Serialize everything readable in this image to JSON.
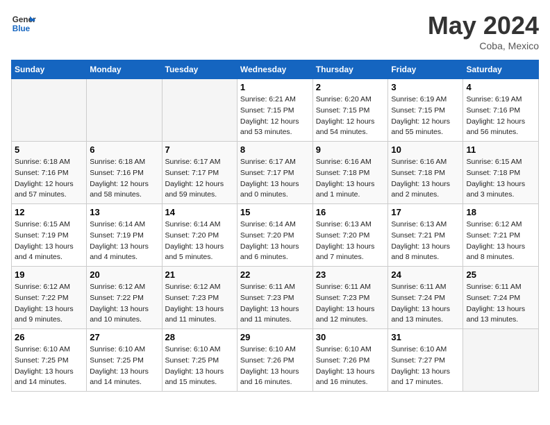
{
  "logo": {
    "line1": "General",
    "line2": "Blue"
  },
  "title": "May 2024",
  "location": "Coba, Mexico",
  "days_header": [
    "Sunday",
    "Monday",
    "Tuesday",
    "Wednesday",
    "Thursday",
    "Friday",
    "Saturday"
  ],
  "weeks": [
    [
      {
        "day": "",
        "sunrise": "",
        "sunset": "",
        "daylight": ""
      },
      {
        "day": "",
        "sunrise": "",
        "sunset": "",
        "daylight": ""
      },
      {
        "day": "",
        "sunrise": "",
        "sunset": "",
        "daylight": ""
      },
      {
        "day": "1",
        "sunrise": "Sunrise: 6:21 AM",
        "sunset": "Sunset: 7:15 PM",
        "daylight": "Daylight: 12 hours and 53 minutes."
      },
      {
        "day": "2",
        "sunrise": "Sunrise: 6:20 AM",
        "sunset": "Sunset: 7:15 PM",
        "daylight": "Daylight: 12 hours and 54 minutes."
      },
      {
        "day": "3",
        "sunrise": "Sunrise: 6:19 AM",
        "sunset": "Sunset: 7:15 PM",
        "daylight": "Daylight: 12 hours and 55 minutes."
      },
      {
        "day": "4",
        "sunrise": "Sunrise: 6:19 AM",
        "sunset": "Sunset: 7:16 PM",
        "daylight": "Daylight: 12 hours and 56 minutes."
      }
    ],
    [
      {
        "day": "5",
        "sunrise": "Sunrise: 6:18 AM",
        "sunset": "Sunset: 7:16 PM",
        "daylight": "Daylight: 12 hours and 57 minutes."
      },
      {
        "day": "6",
        "sunrise": "Sunrise: 6:18 AM",
        "sunset": "Sunset: 7:16 PM",
        "daylight": "Daylight: 12 hours and 58 minutes."
      },
      {
        "day": "7",
        "sunrise": "Sunrise: 6:17 AM",
        "sunset": "Sunset: 7:17 PM",
        "daylight": "Daylight: 12 hours and 59 minutes."
      },
      {
        "day": "8",
        "sunrise": "Sunrise: 6:17 AM",
        "sunset": "Sunset: 7:17 PM",
        "daylight": "Daylight: 13 hours and 0 minutes."
      },
      {
        "day": "9",
        "sunrise": "Sunrise: 6:16 AM",
        "sunset": "Sunset: 7:18 PM",
        "daylight": "Daylight: 13 hours and 1 minute."
      },
      {
        "day": "10",
        "sunrise": "Sunrise: 6:16 AM",
        "sunset": "Sunset: 7:18 PM",
        "daylight": "Daylight: 13 hours and 2 minutes."
      },
      {
        "day": "11",
        "sunrise": "Sunrise: 6:15 AM",
        "sunset": "Sunset: 7:18 PM",
        "daylight": "Daylight: 13 hours and 3 minutes."
      }
    ],
    [
      {
        "day": "12",
        "sunrise": "Sunrise: 6:15 AM",
        "sunset": "Sunset: 7:19 PM",
        "daylight": "Daylight: 13 hours and 4 minutes."
      },
      {
        "day": "13",
        "sunrise": "Sunrise: 6:14 AM",
        "sunset": "Sunset: 7:19 PM",
        "daylight": "Daylight: 13 hours and 4 minutes."
      },
      {
        "day": "14",
        "sunrise": "Sunrise: 6:14 AM",
        "sunset": "Sunset: 7:20 PM",
        "daylight": "Daylight: 13 hours and 5 minutes."
      },
      {
        "day": "15",
        "sunrise": "Sunrise: 6:14 AM",
        "sunset": "Sunset: 7:20 PM",
        "daylight": "Daylight: 13 hours and 6 minutes."
      },
      {
        "day": "16",
        "sunrise": "Sunrise: 6:13 AM",
        "sunset": "Sunset: 7:20 PM",
        "daylight": "Daylight: 13 hours and 7 minutes."
      },
      {
        "day": "17",
        "sunrise": "Sunrise: 6:13 AM",
        "sunset": "Sunset: 7:21 PM",
        "daylight": "Daylight: 13 hours and 8 minutes."
      },
      {
        "day": "18",
        "sunrise": "Sunrise: 6:12 AM",
        "sunset": "Sunset: 7:21 PM",
        "daylight": "Daylight: 13 hours and 8 minutes."
      }
    ],
    [
      {
        "day": "19",
        "sunrise": "Sunrise: 6:12 AM",
        "sunset": "Sunset: 7:22 PM",
        "daylight": "Daylight: 13 hours and 9 minutes."
      },
      {
        "day": "20",
        "sunrise": "Sunrise: 6:12 AM",
        "sunset": "Sunset: 7:22 PM",
        "daylight": "Daylight: 13 hours and 10 minutes."
      },
      {
        "day": "21",
        "sunrise": "Sunrise: 6:12 AM",
        "sunset": "Sunset: 7:23 PM",
        "daylight": "Daylight: 13 hours and 11 minutes."
      },
      {
        "day": "22",
        "sunrise": "Sunrise: 6:11 AM",
        "sunset": "Sunset: 7:23 PM",
        "daylight": "Daylight: 13 hours and 11 minutes."
      },
      {
        "day": "23",
        "sunrise": "Sunrise: 6:11 AM",
        "sunset": "Sunset: 7:23 PM",
        "daylight": "Daylight: 13 hours and 12 minutes."
      },
      {
        "day": "24",
        "sunrise": "Sunrise: 6:11 AM",
        "sunset": "Sunset: 7:24 PM",
        "daylight": "Daylight: 13 hours and 13 minutes."
      },
      {
        "day": "25",
        "sunrise": "Sunrise: 6:11 AM",
        "sunset": "Sunset: 7:24 PM",
        "daylight": "Daylight: 13 hours and 13 minutes."
      }
    ],
    [
      {
        "day": "26",
        "sunrise": "Sunrise: 6:10 AM",
        "sunset": "Sunset: 7:25 PM",
        "daylight": "Daylight: 13 hours and 14 minutes."
      },
      {
        "day": "27",
        "sunrise": "Sunrise: 6:10 AM",
        "sunset": "Sunset: 7:25 PM",
        "daylight": "Daylight: 13 hours and 14 minutes."
      },
      {
        "day": "28",
        "sunrise": "Sunrise: 6:10 AM",
        "sunset": "Sunset: 7:25 PM",
        "daylight": "Daylight: 13 hours and 15 minutes."
      },
      {
        "day": "29",
        "sunrise": "Sunrise: 6:10 AM",
        "sunset": "Sunset: 7:26 PM",
        "daylight": "Daylight: 13 hours and 16 minutes."
      },
      {
        "day": "30",
        "sunrise": "Sunrise: 6:10 AM",
        "sunset": "Sunset: 7:26 PM",
        "daylight": "Daylight: 13 hours and 16 minutes."
      },
      {
        "day": "31",
        "sunrise": "Sunrise: 6:10 AM",
        "sunset": "Sunset: 7:27 PM",
        "daylight": "Daylight: 13 hours and 17 minutes."
      },
      {
        "day": "",
        "sunrise": "",
        "sunset": "",
        "daylight": ""
      }
    ]
  ]
}
